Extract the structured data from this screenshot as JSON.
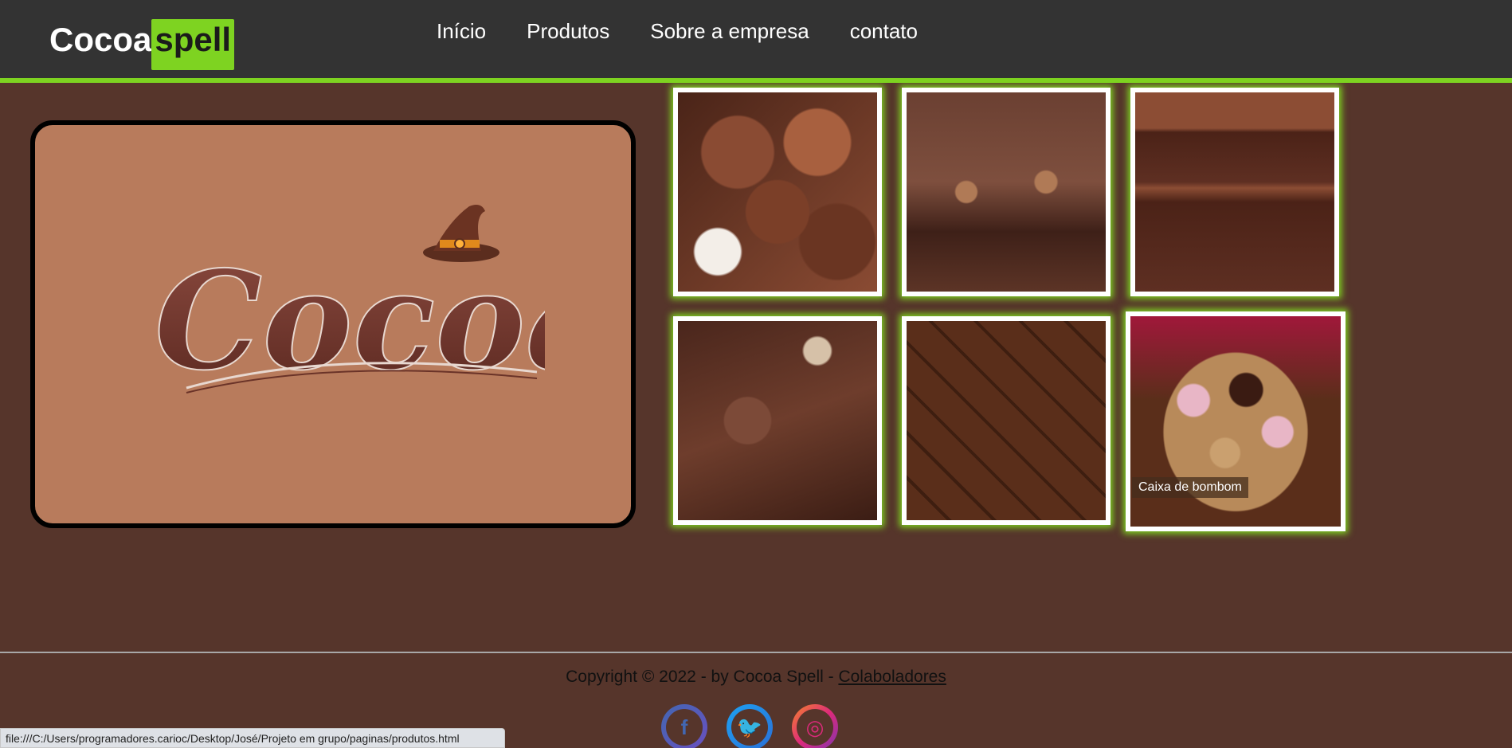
{
  "header": {
    "logo_part1": "Cocoa",
    "logo_part2": "spell",
    "nav": [
      "Início",
      "Produtos",
      "Sobre a empresa",
      "contato"
    ]
  },
  "hero": {
    "logo_text": "Cocoa"
  },
  "gallery": {
    "caption": "Caixa de bombom"
  },
  "footer": {
    "copyright": "Copyright © 2022 - by Cocoa Spell - ",
    "link": "Colaboladores",
    "social": [
      "facebook-icon",
      "twitter-icon",
      "instagram-icon"
    ]
  },
  "status_bar": "file:///C:/Users/programadores.carioc/Desktop/José/Projeto em grupo/paginas/produtos.html",
  "colors": {
    "accent": "#7ed321",
    "header": "#333333",
    "background": "#56352b",
    "hero": "#b87b5c"
  }
}
